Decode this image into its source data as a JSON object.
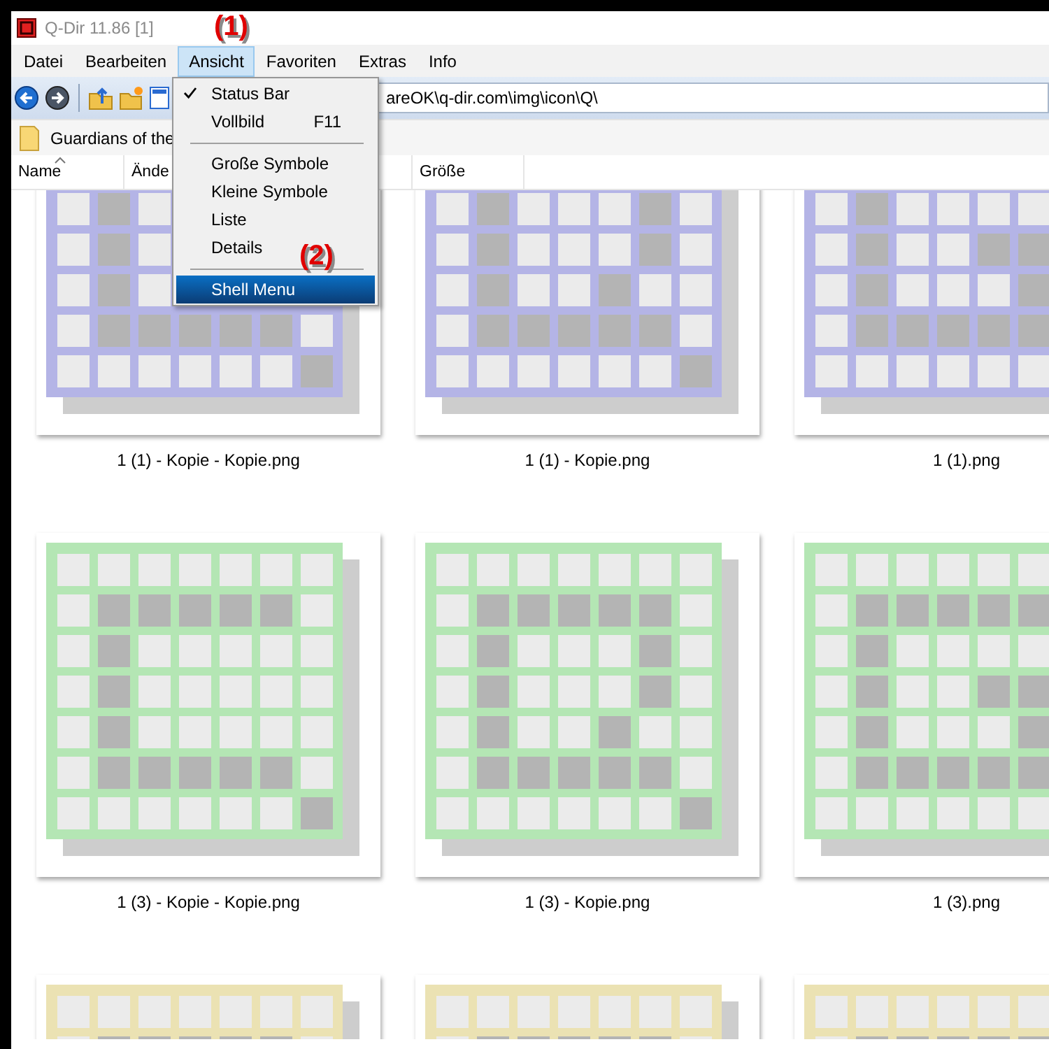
{
  "window": {
    "title": "Q-Dir 11.86 [1]"
  },
  "menu_bar": [
    {
      "label": "Datei",
      "selected": false
    },
    {
      "label": "Bearbeiten",
      "selected": false
    },
    {
      "label": "Ansicht",
      "selected": true
    },
    {
      "label": "Favoriten",
      "selected": false
    },
    {
      "label": "Extras",
      "selected": false
    },
    {
      "label": "Info",
      "selected": false
    }
  ],
  "open_menu": {
    "items": [
      {
        "kind": "item",
        "label": "Status Bar",
        "checked": true,
        "selected": false
      },
      {
        "kind": "item",
        "label": "Vollbild",
        "shortcut": "F11",
        "checked": false,
        "selected": false
      },
      {
        "kind": "separator"
      },
      {
        "kind": "item",
        "label": "Große Symbole",
        "checked": false,
        "selected": false
      },
      {
        "kind": "item",
        "label": "Kleine Symbole",
        "checked": false,
        "selected": false
      },
      {
        "kind": "item",
        "label": "Liste",
        "checked": false,
        "selected": false
      },
      {
        "kind": "item",
        "label": "Details",
        "checked": false,
        "selected": false
      },
      {
        "kind": "separator"
      },
      {
        "kind": "item",
        "label": "Shell Menu",
        "checked": false,
        "selected": true
      }
    ]
  },
  "address_bar": {
    "value": "areOK\\q-dir.com\\img\\icon\\Q\\"
  },
  "folder_bar": {
    "label": "Guardians of the"
  },
  "columns": [
    {
      "label": "Name",
      "sorted": true
    },
    {
      "label": "Ände",
      "sorted": false
    },
    {
      "label": "Größe",
      "sorted": false
    }
  ],
  "files": [
    {
      "name": "1 (1) - Kopie - Kopie.png",
      "color": "#b4b4e6"
    },
    {
      "name": "1 (1) - Kopie.png",
      "color": "#b4b4e6"
    },
    {
      "name": "1 (1).png",
      "color": "#b4b4e6"
    },
    {
      "name": "1 (3) - Kopie - Kopie.png",
      "color": "#b4e6b4"
    },
    {
      "name": "1 (3) - Kopie.png",
      "color": "#b4e6b4"
    },
    {
      "name": "1 (3).png",
      "color": "#b4e6b4"
    },
    {
      "color": "#ebe2b3"
    },
    {
      "color": "#ebe2b3"
    },
    {
      "color": "#ebe2b3"
    }
  ],
  "annotations": [
    "(1)",
    "(2)"
  ]
}
